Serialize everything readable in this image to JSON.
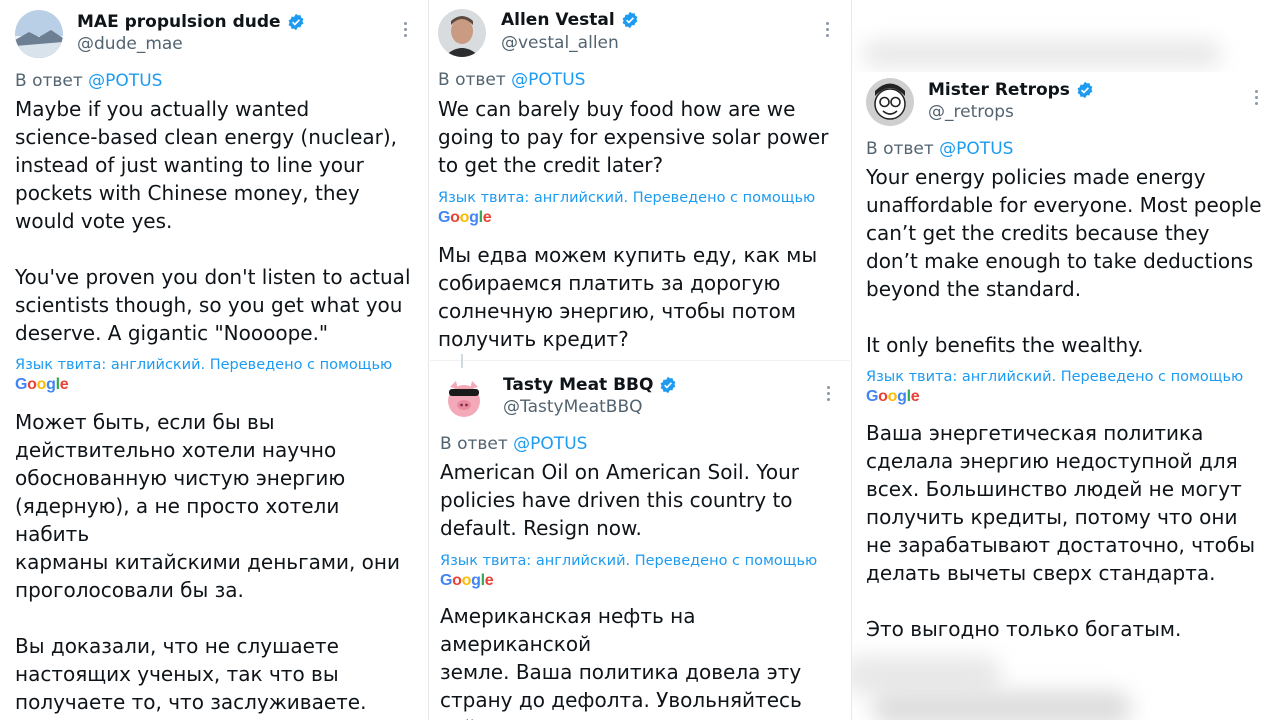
{
  "reply_prefix": "В ответ",
  "mention": "@POTUS",
  "translation_note": "Язык твита: английский. Переведено с помощью",
  "translator_logo": [
    "G",
    "o",
    "o",
    "g",
    "l",
    "e"
  ],
  "colors": {
    "link": "#1d9bf0",
    "secondary_text": "#536471",
    "verified_badge": "#1d9bf0"
  },
  "tweets": [
    {
      "name": "MAE propulsion dude",
      "handle": "@dude_mae",
      "avatar": "landscape-avatar",
      "text_en": "Maybe if you actually wanted\nscience-based clean energy (nuclear),\ninstead of just wanting to line your\npockets with Chinese money, they\nwould vote yes.\n\nYou've proven you don't listen to actual\nscientists though, so you get what you\ndeserve. A gigantic \"Noooope.\"",
      "text_ru": "Может быть, если бы вы\nдействительно хотели научно\nобоснованную чистую энергию\n(ядерную), а не просто хотели набить\nкарманы китайскими деньгами, они\nпроголосовали бы за.\n\nВы доказали, что не слушаете\nнастоящих ученых, так что вы\nполучаете то, что заслуживаете.\nГигантское \"Нееeет\"."
    },
    {
      "name": "Allen Vestal",
      "handle": "@vestal_allen",
      "avatar": "portrait-avatar",
      "text_en": "We can barely buy food how are we\ngoing to pay for expensive solar power\nto get the credit later?",
      "text_ru": "Мы едва можем купить еду, как мы\nсобираемся платить за дорогую\nсолнечную энергию, чтобы потом\nполучить кредит?"
    },
    {
      "name": "Tasty Meat BBQ",
      "handle": "@TastyMeatBBQ",
      "avatar": "cartoon-pig-avatar",
      "text_en": "American Oil on American Soil.  Your\npolicies have driven this country to\ndefault. Resign now.",
      "text_ru": "Американская нефть на американской\nземле. Ваша политика довела эту\nстрану до дефолта. Увольняйтесь\nсейчас."
    },
    {
      "name": "Mister Retrops",
      "handle": "@_retrops",
      "avatar": "cartoon-face-avatar",
      "text_en": "Your energy policies made energy\nunaffordable for everyone. Most people\ncan’t get the credits because they\ndon’t make enough to take deductions\nbeyond the standard.\n\nIt only benefits the wealthy.",
      "text_ru": "Ваша энергетическая политика\nсделала энергию недоступной для\nвсех. Большинство людей не могут\nполучить кредиты, потому что они\nне зарабатывают достаточно, чтобы\nделать вычеты сверх стандарта.\n\nЭто выгодно только богатым."
    }
  ]
}
